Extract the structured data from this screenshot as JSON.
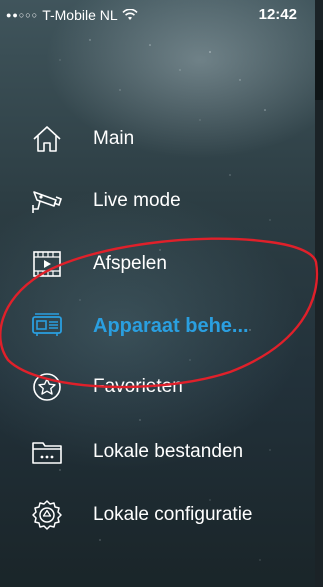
{
  "status_bar": {
    "signal_dots": "●●○○○",
    "carrier": "T-Mobile NL",
    "time": "12:42"
  },
  "menu": {
    "items": [
      {
        "label": "Main",
        "icon": "home-icon",
        "active": false
      },
      {
        "label": "Live mode",
        "icon": "camera-icon",
        "active": false
      },
      {
        "label": "Afspelen",
        "icon": "playback-icon",
        "active": false
      },
      {
        "label": "Apparaat behe...",
        "icon": "device-icon",
        "active": true
      },
      {
        "label": "Favorieten",
        "icon": "star-icon",
        "active": false
      },
      {
        "label": "Lokale bestanden",
        "icon": "folder-icon",
        "active": false
      },
      {
        "label": "Lokale configuratie",
        "icon": "gear-icon",
        "active": false
      }
    ]
  },
  "colors": {
    "accent": "#2a9fe0",
    "annotation": "#e0202a"
  }
}
